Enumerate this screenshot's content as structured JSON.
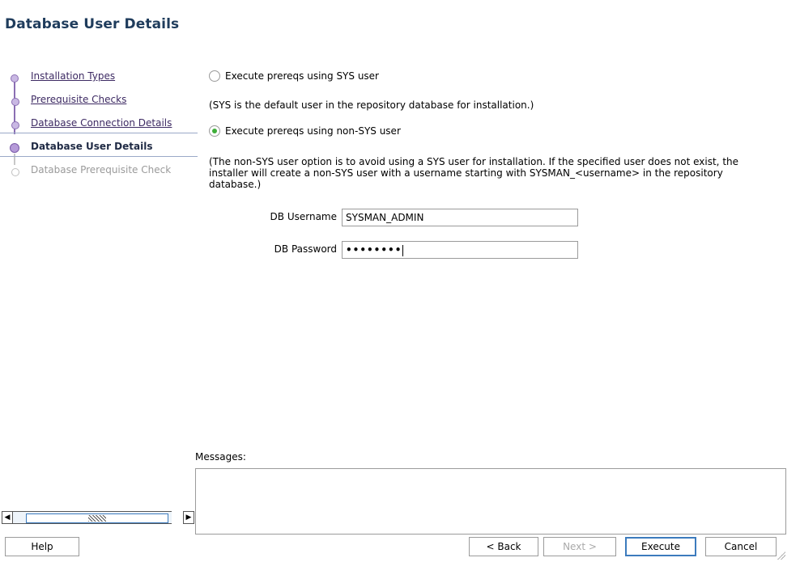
{
  "page_title": "Database User Details",
  "steps": [
    {
      "label": "Installation Types",
      "state": "link"
    },
    {
      "label": "Prerequisite Checks",
      "state": "link"
    },
    {
      "label": "Database Connection Details",
      "state": "link"
    },
    {
      "label": "Database User Details",
      "state": "current"
    },
    {
      "label": "Database Prerequisite Check",
      "state": "disabled"
    }
  ],
  "options": {
    "sys_label": "Execute prereqs using SYS user",
    "sys_note": "(SYS is the default user in the repository database for installation.)",
    "nonsys_label": "Execute prereqs using non-SYS user",
    "nonsys_note": "(The non-SYS user option is to avoid using a SYS user for installation. If the specified user does not exist, the installer will create a non-SYS user with a username starting with SYSMAN_<username> in the repository database.)",
    "selected": "nonsys"
  },
  "form": {
    "username_label": "DB Username",
    "username_value": "SYSMAN_ADMIN",
    "password_label": "DB Password",
    "password_value": "••••••••"
  },
  "messages": {
    "label": "Messages:"
  },
  "buttons": {
    "help": "Help",
    "back": "< Back",
    "next": "Next >",
    "execute": "Execute",
    "cancel": "Cancel"
  }
}
